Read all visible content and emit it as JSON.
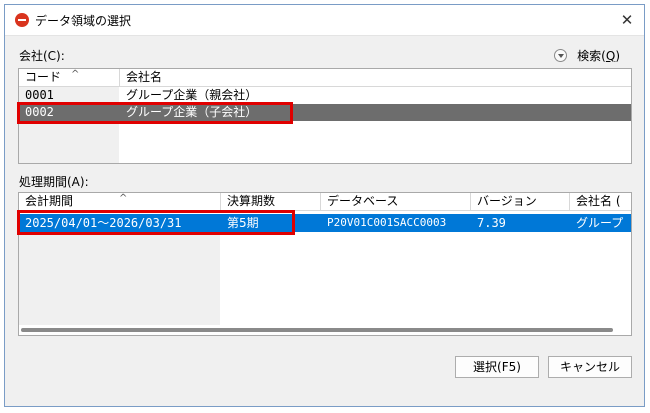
{
  "window": {
    "title": "データ領域の選択",
    "close": "✕"
  },
  "company": {
    "label": "会社(C):",
    "search_label": "検索",
    "search_key": "Q",
    "columns": [
      "コード",
      "会社名"
    ],
    "rows": [
      {
        "code": "0001",
        "name": "グループ企業（親会社）"
      },
      {
        "code": "0002",
        "name": "グループ企業（子会社）"
      }
    ]
  },
  "period": {
    "label": "処理期間(A):",
    "columns": [
      "会計期間",
      "決算期数",
      "データベース",
      "バージョン",
      "会社名 ("
    ],
    "rows": [
      {
        "period": "2025/04/01～2026/03/31",
        "term": "第5期",
        "database": "P20V01C001SACC0003",
        "version": "7.39",
        "company": "グループ"
      }
    ]
  },
  "buttons": {
    "select": "選択(F5)",
    "cancel": "キャンセル"
  },
  "colors": {
    "selected_row": "#0078d7",
    "inactive_selected_row": "#6d6d6d",
    "highlight_box": "#e00000"
  },
  "icons": [
    "app-logo-icon",
    "close-icon",
    "search-expand-icon",
    "sort-ascending-icon"
  ]
}
